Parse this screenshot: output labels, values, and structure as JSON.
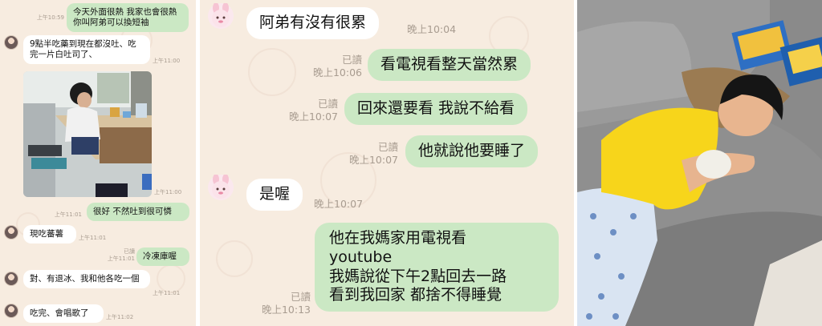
{
  "left_chat": {
    "messages": [
      {
        "text": "今天外面很熱 我家也會很熱 你叫阿弟可以換短袖",
        "side": "out",
        "time": "上午10:59"
      },
      {
        "text": "9點半吃藥到現在都沒吐、吃完一片白吐司了、",
        "side": "in",
        "time": "上午11:00"
      },
      {
        "time": "上午11:00"
      },
      {
        "text": "很好 不然吐到很可憐",
        "side": "out",
        "time": "上午11:01"
      },
      {
        "text": "現吃蕃薯",
        "side": "in",
        "time": "上午11:01"
      },
      {
        "text": "冷凍庫喔",
        "side": "out",
        "read": "已讀",
        "time": "上午11:01"
      },
      {
        "text": "對、有退冰、我和他各吃一個",
        "side": "in",
        "time": "上午11:01"
      },
      {
        "text": "吃完、會唱歌了",
        "side": "in",
        "time": "上午11:02"
      }
    ]
  },
  "mid_chat": {
    "messages": [
      {
        "text": "阿弟有沒有很累",
        "side": "in",
        "time": "晚上10:04"
      },
      {
        "text": "看電視看整天當然累",
        "side": "out",
        "read": "已讀",
        "time": "晚上10:06"
      },
      {
        "text": "回來還要看 我說不給看",
        "side": "out",
        "read": "已讀",
        "time": "晚上10:07"
      },
      {
        "text": "他就說他要睡了",
        "side": "out",
        "read": "已讀",
        "time": "晚上10:07"
      },
      {
        "text": "是喔",
        "side": "in",
        "time": "晚上10:07"
      },
      {
        "lines": [
          "他在我媽家用電視看",
          "youtube",
          "我媽說從下午2點回去一路",
          "看到我回家 都捨不得睡覺"
        ],
        "side": "out",
        "read": "已讀",
        "time": "晚上10:13"
      }
    ]
  },
  "colors": {
    "chat_background": "#f7ece0",
    "incoming_bubble": "#ffffff",
    "outgoing_bubble": "#cbe8c4",
    "meta_text": "#a89c90",
    "pajama_blue": "#d9e4f2",
    "yellow_shirt": "#f7d51b"
  }
}
